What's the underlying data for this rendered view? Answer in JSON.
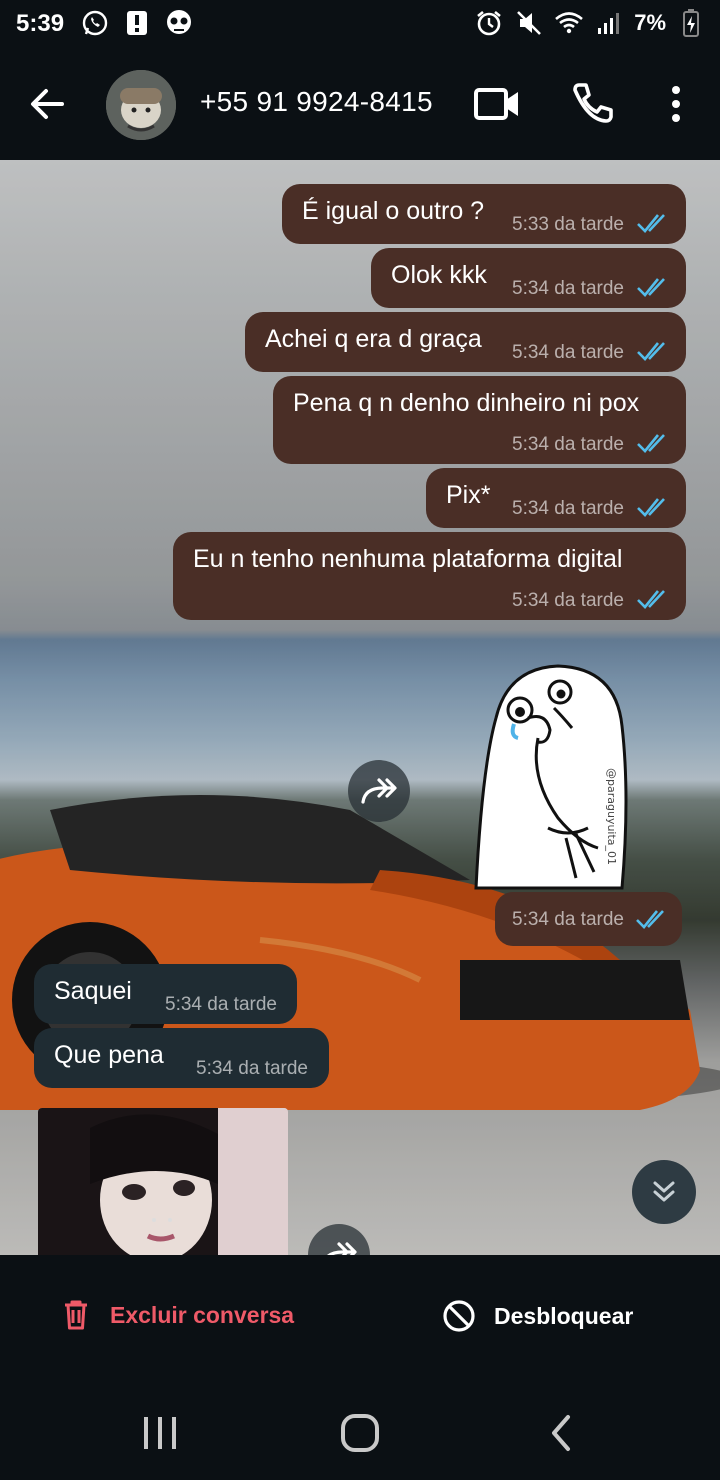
{
  "status_bar": {
    "time": "5:39",
    "battery": "7%",
    "icons_left": [
      "whatsapp-icon",
      "alert-icon",
      "skull-icon"
    ],
    "icons_right": [
      "alarm-icon",
      "mute-icon",
      "wifi-icon",
      "signal-icon",
      "battery-charging-icon"
    ]
  },
  "header": {
    "contact_name": "+55 91 9924-8415",
    "icons": [
      "back-arrow-icon",
      "video-call-icon",
      "phone-call-icon",
      "more-vert-icon"
    ]
  },
  "messages": [
    {
      "direction": "out",
      "text": "É igual o outro ?",
      "time": "5:33 da tarde",
      "status": "read"
    },
    {
      "direction": "out",
      "text": "Olok kkk",
      "time": "5:34 da tarde",
      "status": "read"
    },
    {
      "direction": "out",
      "text": "Achei q era d graça",
      "time": "5:34 da tarde",
      "status": "read"
    },
    {
      "direction": "out",
      "text": "Pena q n denho dinheiro ni pox",
      "time": "5:34 da tarde",
      "status": "read"
    },
    {
      "direction": "out",
      "text": "Pix*",
      "time": "5:34 da tarde",
      "status": "read"
    },
    {
      "direction": "out",
      "text": "Eu n tenho nenhuma plataforma digital",
      "time": "5:34 da tarde",
      "status": "read"
    },
    {
      "direction": "out",
      "type": "sticker",
      "time": "5:34 da tarde",
      "status": "read"
    },
    {
      "direction": "in",
      "text": "Saquei",
      "time": "5:34 da tarde"
    },
    {
      "direction": "in",
      "text": "Que pena",
      "time": "5:34 da tarde"
    },
    {
      "direction": "in",
      "type": "photo"
    }
  ],
  "sticker_watermark": "@paraguyuita_01",
  "actions": {
    "delete_label": "Excluir conversa",
    "unblock_label": "Desbloquear"
  },
  "colors": {
    "outgoing_bubble": "#4a2e26",
    "incoming_bubble": "#1f2c33",
    "read_ticks": "#53bdeb",
    "delete_red": "#ef5a68",
    "bar_background": "#0b1014"
  }
}
